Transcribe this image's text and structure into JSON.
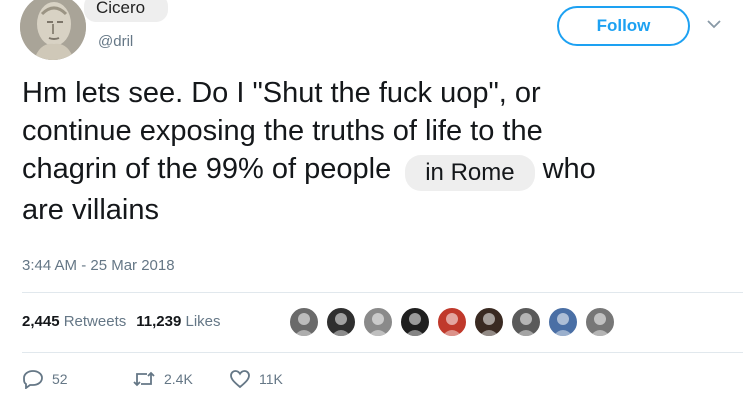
{
  "author": {
    "name": "Cicero",
    "handle": "@dril"
  },
  "follow_button": {
    "label": "Follow"
  },
  "tweet": {
    "lines": [
      "Hm lets see. Do I \"Shut the fuck uop\", or",
      "continue exposing the truths of life to the",
      "chagrin of the 99% of people",
      "are villains"
    ],
    "overlay_text": "in Rome",
    "line3_end": "who"
  },
  "timestamp": "3:44 AM - 25 Mar 2018",
  "stats": {
    "retweets_count": "2,445",
    "retweets_label": "Retweets",
    "likes_count": "11,239",
    "likes_label": "Likes"
  },
  "liker_avatars": [
    {
      "icon": "liker-avatar-1",
      "color": "#6a6a6a"
    },
    {
      "icon": "liker-avatar-2",
      "color": "#2f2f2f"
    },
    {
      "icon": "liker-avatar-3",
      "color": "#8a8a8a"
    },
    {
      "icon": "liker-avatar-4",
      "color": "#1f1f1f"
    },
    {
      "icon": "liker-avatar-5",
      "color": "#c0392b"
    },
    {
      "icon": "liker-avatar-6",
      "color": "#3a2a22"
    },
    {
      "icon": "liker-avatar-7",
      "color": "#5a5a5a"
    },
    {
      "icon": "liker-avatar-8",
      "color": "#4a6fa5"
    },
    {
      "icon": "liker-avatar-9",
      "color": "#777777"
    }
  ],
  "actions": {
    "reply_count": "52",
    "retweet_count": "2.4K",
    "like_count": "11K"
  },
  "colors": {
    "accent": "#1da1f2",
    "muted": "#657786",
    "text": "#14171a"
  }
}
